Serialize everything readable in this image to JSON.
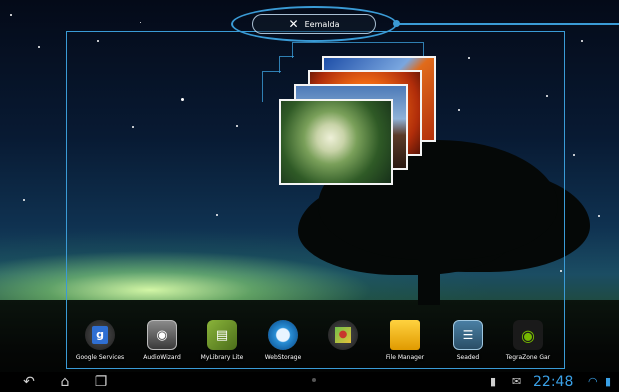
{
  "header": {
    "remove_label": "Eemalda"
  },
  "dock": {
    "apps": [
      {
        "label": "Google Services",
        "icon": "google-services-icon",
        "color": "#c8372d"
      },
      {
        "label": "AudioWizard",
        "icon": "audiowizard-icon",
        "color": "#5a5a5a"
      },
      {
        "label": "MyLibrary Lite",
        "icon": "mylibrary-icon",
        "color": "#6b8f2a"
      },
      {
        "label": "WebStorage",
        "icon": "webstorage-icon",
        "color": "#2a8fd6"
      },
      {
        "label": "",
        "icon": "maps-icon",
        "color": "#3b7c2f"
      },
      {
        "label": "File Manager",
        "icon": "folder-icon",
        "color": "#f0b400"
      },
      {
        "label": "Seaded",
        "icon": "settings-icon",
        "color": "#3a6a8a"
      },
      {
        "label": "TegraZone Gar",
        "icon": "tegrazone-icon",
        "color": "#76b900"
      }
    ]
  },
  "status_bar": {
    "time": "22:48"
  },
  "colors": {
    "accent": "#3a9bd6",
    "clock": "#3aa0e6"
  }
}
